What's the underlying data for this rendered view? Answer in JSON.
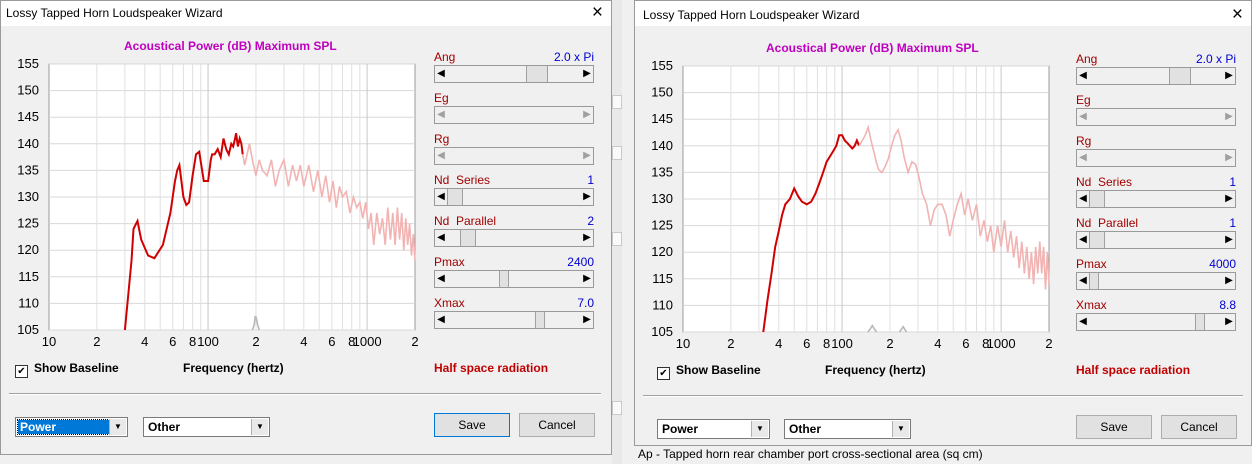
{
  "left": {
    "title": "Lossy Tapped Horn Loudspeaker Wizard",
    "close": "×",
    "chart_title": "Acoustical Power (dB)   Maximum SPL",
    "controls": [
      {
        "label": "Ang",
        "value": "2.0 x Pi",
        "thumb": 0.73
      },
      {
        "label": "Eg",
        "value": "",
        "thumb": null
      },
      {
        "label": "Rg",
        "value": "",
        "thumb": null
      },
      {
        "label": "Nd  Series",
        "value": "1",
        "thumb": 0.0
      },
      {
        "label": "Nd  Parallel",
        "value": "2",
        "thumb": 0.1
      },
      {
        "label": "Pmax",
        "value": "2400",
        "thumb": 0.39
      },
      {
        "label": "Xmax",
        "value": "7.0",
        "thumb": 0.74
      }
    ],
    "show_baseline": "Show Baseline",
    "frequency_label": "Frequency (hertz)",
    "radiation": "Half space radiation",
    "combo1": "Power",
    "combo2": "Other",
    "save": "Save",
    "cancel": "Cancel"
  },
  "right": {
    "title": "Lossy Tapped Horn Loudspeaker Wizard",
    "close": "×",
    "chart_title": "Acoustical Power (dB)   Maximum SPL",
    "controls": [
      {
        "label": "Ang",
        "value": "2.0 x Pi",
        "thumb": 0.73
      },
      {
        "label": "Eg",
        "value": "",
        "thumb": null
      },
      {
        "label": "Rg",
        "value": "",
        "thumb": null
      },
      {
        "label": "Nd  Series",
        "value": "1",
        "thumb": 0.0
      },
      {
        "label": "Nd  Parallel",
        "value": "1",
        "thumb": 0.0
      },
      {
        "label": "Pmax",
        "value": "4000",
        "thumb": 0.0
      },
      {
        "label": "Xmax",
        "value": "8.8",
        "thumb": 0.84
      }
    ],
    "show_baseline": "Show Baseline",
    "frequency_label": "Frequency (hertz)",
    "radiation": "Half space radiation",
    "combo1": "Power",
    "combo2": "Other",
    "save": "Save",
    "cancel": "Cancel"
  },
  "status_text": "Ap - Tapped horn rear chamber port cross-sectional area (sq cm)",
  "chart_data": [
    {
      "type": "line",
      "title": "Acoustical Power (dB)   Maximum SPL",
      "xlabel": "Frequency (hertz)",
      "ylabel": "",
      "x_scale": "log",
      "xlim": [
        10,
        2000
      ],
      "ylim": [
        105,
        155
      ],
      "x_tick_labels": [
        "10",
        "2",
        "4",
        "6",
        "8",
        "100",
        "2",
        "4",
        "6",
        "8",
        "1000",
        "2"
      ],
      "y_ticks": [
        105,
        110,
        115,
        120,
        125,
        130,
        135,
        140,
        145,
        150,
        155
      ],
      "grid": true,
      "colors": {
        "power_limited": "#d00000",
        "excursion_limited": "#f2b3b3",
        "baseline": "#b8b8b8"
      },
      "series": [
        {
          "x": [
            30,
            33,
            34,
            36,
            38,
            42,
            46,
            52,
            58,
            62,
            64,
            66,
            68,
            70,
            73,
            76,
            80,
            84,
            88,
            94,
            100,
            104,
            106,
            110,
            115,
            120,
            125,
            130,
            135,
            140,
            144,
            148,
            150,
            154,
            158,
            162,
            165
          ],
          "y": [
            105,
            118,
            124,
            125.5,
            122,
            119,
            118.5,
            121,
            127,
            133,
            135,
            136,
            133,
            130,
            128.5,
            129,
            134,
            138,
            138.5,
            133,
            133,
            137,
            138,
            138,
            139,
            137.5,
            141,
            139,
            138,
            140,
            139.5,
            141,
            142,
            139.5,
            141,
            140,
            138
          ]
        },
        {
          "x": [
            165,
            170,
            176,
            182,
            190,
            200,
            210,
            220,
            235,
            250,
            265,
            280,
            300,
            320,
            340,
            360,
            380,
            400,
            430,
            460,
            490,
            520,
            550,
            580,
            610,
            640,
            670,
            700,
            740,
            780,
            820,
            860,
            900,
            940,
            980,
            1020,
            1060,
            1100,
            1150,
            1200,
            1250,
            1300,
            1350,
            1400,
            1450,
            1500,
            1550,
            1600,
            1650,
            1700,
            1750,
            1800,
            1850,
            1900,
            1950,
            2000
          ],
          "y": [
            138,
            136,
            138,
            140,
            137,
            134,
            137,
            135,
            134,
            137,
            132,
            135,
            137,
            132,
            136,
            133,
            136,
            132,
            136,
            131,
            135,
            130,
            134,
            129,
            133,
            128,
            132,
            130,
            131,
            127,
            130,
            128,
            129,
            126,
            129,
            124,
            127,
            121,
            127,
            123,
            126,
            121,
            128,
            122,
            127,
            121,
            128,
            122,
            127,
            120,
            126,
            121,
            125,
            119,
            123,
            118
          ]
        },
        {
          "x": [
            190,
            195,
            198,
            200,
            202,
            205,
            210
          ],
          "y": [
            105,
            106,
            107.5,
            107.5,
            107,
            106,
            105
          ]
        }
      ]
    },
    {
      "type": "line",
      "title": "Acoustical Power (dB)   Maximum SPL",
      "xlabel": "Frequency (hertz)",
      "ylabel": "",
      "x_scale": "log",
      "xlim": [
        10,
        2000
      ],
      "ylim": [
        105,
        155
      ],
      "x_tick_labels": [
        "10",
        "2",
        "4",
        "6",
        "8",
        "100",
        "2",
        "4",
        "6",
        "8",
        "1000",
        "2"
      ],
      "y_ticks": [
        105,
        110,
        115,
        120,
        125,
        130,
        135,
        140,
        145,
        150,
        155
      ],
      "grid": true,
      "colors": {
        "power_limited": "#d00000",
        "excursion_limited": "#f2b3b3",
        "baseline": "#b8b8b8"
      },
      "series": [
        {
          "x": [
            32,
            34,
            36,
            38,
            40,
            42,
            44,
            47,
            50,
            53,
            56,
            60,
            64,
            68,
            72,
            76,
            80,
            84,
            88,
            92,
            96,
            100,
            104,
            108,
            112,
            116,
            120,
            124,
            128
          ],
          "y": [
            105,
            111,
            116,
            121,
            124,
            127,
            129,
            130,
            132,
            130.5,
            129.5,
            129,
            129.5,
            131,
            133,
            135,
            137,
            138,
            139,
            140,
            142,
            142,
            141,
            140.5,
            140,
            139.5,
            140,
            141,
            140
          ]
        },
        {
          "x": [
            128,
            134,
            140,
            146,
            152,
            158,
            164,
            170,
            178,
            186,
            195,
            205,
            215,
            225,
            235,
            245,
            260,
            275,
            290,
            305,
            320,
            340,
            360,
            380,
            400,
            425,
            450,
            475,
            500,
            530,
            560,
            590,
            620,
            660,
            700,
            740,
            780,
            820,
            860,
            900,
            950,
            1000,
            1050,
            1100,
            1150,
            1200,
            1250,
            1300,
            1350,
            1400,
            1450,
            1500,
            1550,
            1600,
            1650,
            1700,
            1750,
            1800,
            1850,
            1900,
            1950,
            2000
          ],
          "y": [
            140,
            141,
            142,
            143.5,
            141,
            139,
            137,
            135.5,
            135,
            136,
            137.5,
            140,
            142,
            143,
            141,
            138,
            135,
            137,
            136.5,
            134,
            131,
            129,
            125,
            128,
            129,
            129,
            127,
            123,
            126,
            129,
            131,
            127,
            130,
            126,
            129,
            123,
            126,
            122,
            125,
            120,
            125,
            121,
            126,
            120,
            124,
            119,
            123,
            117,
            122,
            116,
            121,
            115,
            120,
            114,
            121,
            116,
            122,
            116,
            121,
            113,
            120,
            114
          ]
        },
        {
          "x": [
            145,
            150,
            155,
            160,
            165
          ],
          "y": [
            105,
            105.5,
            106.2,
            105.5,
            105
          ]
        },
        {
          "x": [
            230,
            236,
            242,
            248,
            254
          ],
          "y": [
            105,
            105.5,
            106,
            105.5,
            105
          ]
        }
      ]
    }
  ]
}
